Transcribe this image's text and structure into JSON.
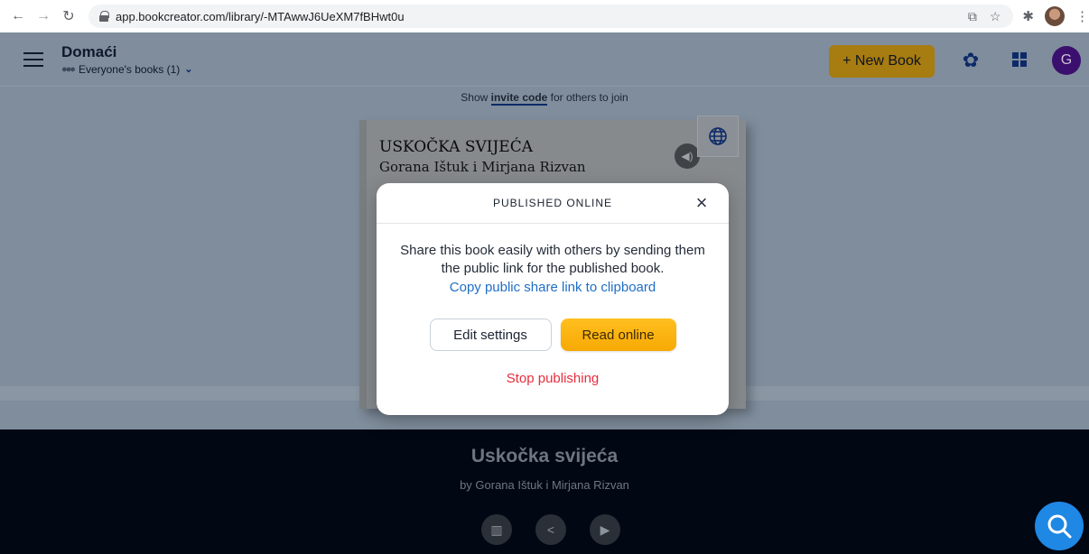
{
  "browser": {
    "url": "app.bookcreator.com/library/-MTAwwJ6UeXM7fBHwt0u",
    "icons": [
      "back-icon",
      "forward-icon",
      "reload-icon",
      "lock-icon",
      "install-icon",
      "star-icon",
      "extensions-icon",
      "profile-avatar",
      "kebab-menu-icon"
    ]
  },
  "header": {
    "library_title": "Domaći",
    "library_sub": "Everyone's books (1)",
    "new_book_label": "+ New Book",
    "avatar_letter": "G",
    "colors": {
      "new_book_bg": "#a77c10",
      "avatar_bg": "#3b0f6e",
      "icon_color": "#0d2a68"
    }
  },
  "invite": {
    "prefix": "Show ",
    "link": "invite code",
    "suffix": " for others to join"
  },
  "book": {
    "title": "USKOČKA SVIJEĆA",
    "author": "Gorana Ištuk i Mirjana Rizvan"
  },
  "footer": {
    "title": "Uskočka svijeća",
    "byline": "by Gorana Ištuk i Mirjana Rizvan",
    "icons": [
      "library-icon",
      "share-icon",
      "play-icon"
    ]
  },
  "modal": {
    "title": "PUBLISHED ONLINE",
    "close": "×",
    "description": "Share this book easily with others by sending them the public link for the published book.",
    "copy_link": "Copy public share link to clipboard",
    "edit_label": "Edit settings",
    "read_label": "Read online",
    "stop_label": "Stop publishing",
    "colors": {
      "link": "#1f6ec7",
      "stop": "#e62e3d",
      "read_bg": "#fbb612"
    }
  }
}
